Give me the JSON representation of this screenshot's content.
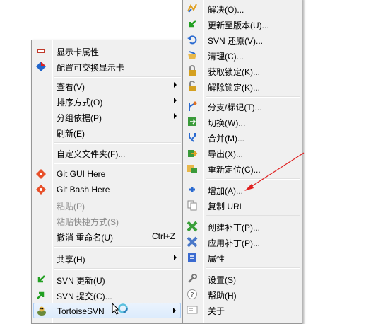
{
  "context_menu": {
    "items": [
      {
        "label": "显示卡属性",
        "icon": "display-adapter-icon"
      },
      {
        "label": "配置可交换显示卡",
        "icon": "switchable-graphics-icon"
      },
      {
        "label": "查看(V)",
        "submenu": true
      },
      {
        "label": "排序方式(O)",
        "submenu": true
      },
      {
        "label": "分组依据(P)",
        "submenu": true
      },
      {
        "label": "刷新(E)"
      },
      {
        "label": "自定义文件夹(F)..."
      },
      {
        "label": "Git GUI Here",
        "icon": "git-icon"
      },
      {
        "label": "Git Bash Here",
        "icon": "git-icon"
      },
      {
        "label": "粘贴(P)",
        "disabled": true
      },
      {
        "label": "粘贴快捷方式(S)",
        "disabled": true
      },
      {
        "label": "撤消 重命名(U)",
        "shortcut": "Ctrl+Z"
      },
      {
        "label": "共享(H)",
        "submenu": true
      },
      {
        "label": "SVN 更新(U)",
        "icon": "svn-update-icon"
      },
      {
        "label": "SVN 提交(C)...",
        "icon": "svn-commit-icon"
      },
      {
        "label": "TortoiseSVN",
        "icon": "tortoisesvn-icon",
        "submenu": true
      }
    ]
  },
  "tortoise_submenu": {
    "items": [
      {
        "label": "解决(O)...",
        "icon": "resolve-icon"
      },
      {
        "label": "更新至版本(U)...",
        "icon": "update-to-revision-icon"
      },
      {
        "label": "SVN 还原(V)...",
        "icon": "revert-icon"
      },
      {
        "label": "清理(C)...",
        "icon": "cleanup-icon"
      },
      {
        "label": "获取锁定(K)...",
        "icon": "lock-icon"
      },
      {
        "label": "解除锁定(K)...",
        "icon": "unlock-icon"
      },
      {
        "label": "分支/标记(T)...",
        "icon": "branch-tag-icon"
      },
      {
        "label": "切换(W)...",
        "icon": "switch-icon"
      },
      {
        "label": "合并(M)...",
        "icon": "merge-icon"
      },
      {
        "label": "导出(X)...",
        "icon": "export-icon"
      },
      {
        "label": "重新定位(C)...",
        "icon": "relocate-icon"
      },
      {
        "label": "增加(A)...",
        "icon": "add-icon"
      },
      {
        "label": "复制 URL",
        "icon": "copy-url-icon"
      },
      {
        "label": "创建补丁(P)...",
        "icon": "create-patch-icon"
      },
      {
        "label": "应用补丁(P)...",
        "icon": "apply-patch-icon"
      },
      {
        "label": "属性",
        "icon": "properties-icon"
      },
      {
        "label": "设置(S)",
        "icon": "settings-icon"
      },
      {
        "label": "帮助(H)",
        "icon": "help-icon"
      },
      {
        "label": "关于",
        "icon": "about-icon"
      }
    ]
  },
  "colors": {
    "menu_bg": "#f0f0f0",
    "highlight": "#dcebfc",
    "annotation_arrow": "#e02020"
  }
}
